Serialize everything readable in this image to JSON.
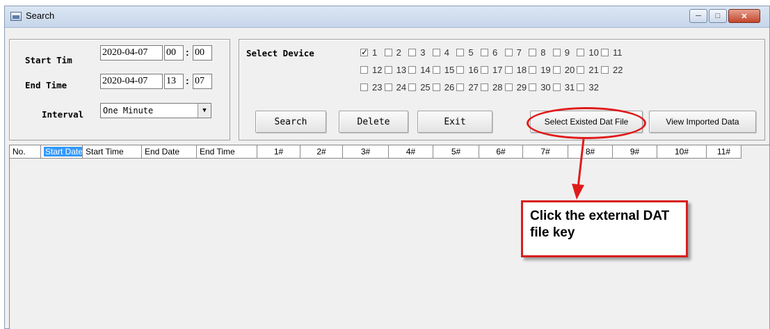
{
  "window": {
    "title": "Search"
  },
  "time": {
    "start_label": "Start Tim",
    "start_date": "2020-04-07",
    "start_hour": "00",
    "start_min": "00",
    "end_label": "End Time",
    "end_date": "2020-04-07",
    "end_hour": "13",
    "end_min": "07",
    "colon": ":",
    "interval_label": "Interval",
    "interval_value": "One Minute"
  },
  "device": {
    "label": "Select Device",
    "checkboxes": [
      {
        "n": "1",
        "checked": true
      },
      {
        "n": "2",
        "checked": false
      },
      {
        "n": "3",
        "checked": false
      },
      {
        "n": "4",
        "checked": false
      },
      {
        "n": "5",
        "checked": false
      },
      {
        "n": "6",
        "checked": false
      },
      {
        "n": "7",
        "checked": false
      },
      {
        "n": "8",
        "checked": false
      },
      {
        "n": "9",
        "checked": false
      },
      {
        "n": "10",
        "checked": false
      },
      {
        "n": "11",
        "checked": false
      },
      {
        "n": "12",
        "checked": false
      },
      {
        "n": "13",
        "checked": false
      },
      {
        "n": "14",
        "checked": false
      },
      {
        "n": "15",
        "checked": false
      },
      {
        "n": "16",
        "checked": false
      },
      {
        "n": "17",
        "checked": false
      },
      {
        "n": "18",
        "checked": false
      },
      {
        "n": "19",
        "checked": false
      },
      {
        "n": "20",
        "checked": false
      },
      {
        "n": "21",
        "checked": false
      },
      {
        "n": "22",
        "checked": false
      },
      {
        "n": "23",
        "checked": false
      },
      {
        "n": "24",
        "checked": false
      },
      {
        "n": "25",
        "checked": false
      },
      {
        "n": "26",
        "checked": false
      },
      {
        "n": "27",
        "checked": false
      },
      {
        "n": "28",
        "checked": false
      },
      {
        "n": "29",
        "checked": false
      },
      {
        "n": "30",
        "checked": false
      },
      {
        "n": "31",
        "checked": false
      },
      {
        "n": "32",
        "checked": false
      }
    ]
  },
  "buttons": {
    "search": "Search",
    "delete": "Delete",
    "exit": "Exit",
    "select_dat": "Select Existed Dat File",
    "view_imported": "View Imported Data"
  },
  "table": {
    "columns": [
      "No.",
      "Start Date",
      "Start Time",
      "End Date",
      "End Time",
      "1#",
      "2#",
      "3#",
      "4#",
      "5#",
      "6#",
      "7#",
      "8#",
      "9#",
      "10#",
      "11#"
    ],
    "selected_column": "Start Date"
  },
  "annotation": {
    "callout_text": "Click the external DAT file key",
    "color": "#e01b1b"
  }
}
